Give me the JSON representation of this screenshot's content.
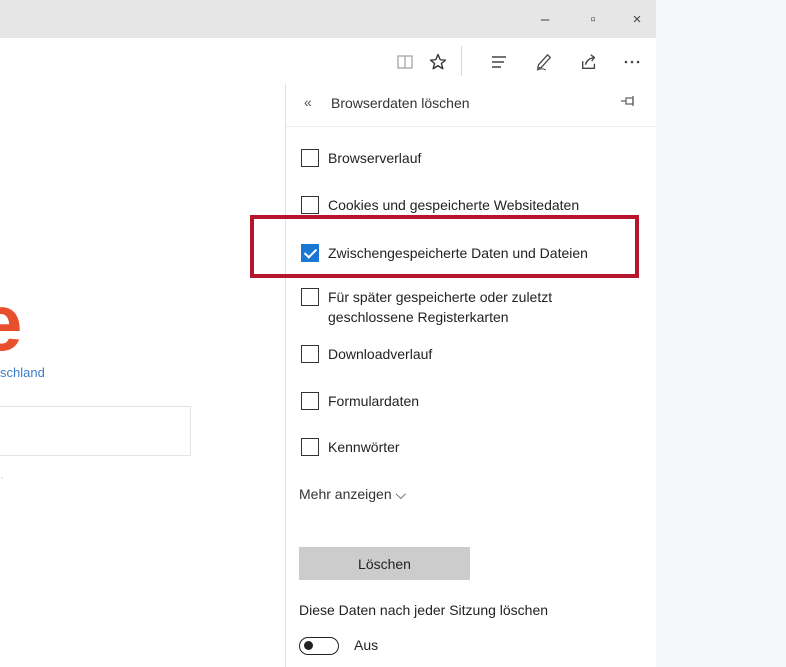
{
  "window": {
    "minimize": "–",
    "maximize": "▫",
    "close": "×"
  },
  "toolbar": {
    "icons": [
      "reading-view-icon",
      "favorites-star-icon",
      "hub-icon",
      "notes-pen-icon",
      "share-icon",
      "more-icon"
    ]
  },
  "page": {
    "logo": "e",
    "subtitle": "schland"
  },
  "panel": {
    "back_glyph": "«",
    "title": "Browserdaten löschen",
    "pin_glyph": "⊣⊏",
    "options": [
      {
        "label": "Browserverlauf",
        "checked": false
      },
      {
        "label": "Cookies und gespeicherte Websitedaten",
        "checked": false
      },
      {
        "label": "Zwischengespeicherte Daten und Dateien",
        "checked": true
      },
      {
        "label": "Für später gespeicherte oder zuletzt geschlossene Registerkarten",
        "checked": false
      },
      {
        "label": "Downloadverlauf",
        "checked": false
      },
      {
        "label": "Formulardaten",
        "checked": false
      },
      {
        "label": "Kennwörter",
        "checked": false
      }
    ],
    "more_label": "Mehr anzeigen ⌵",
    "delete_label": "Löschen",
    "auto_clear_label": "Diese Daten nach jeder Sitzung löschen",
    "toggle_state": "Aus"
  },
  "colors": {
    "checkbox_checked": "#1a78d4",
    "highlight_border": "#b5162d",
    "logo": "#e8502d"
  }
}
